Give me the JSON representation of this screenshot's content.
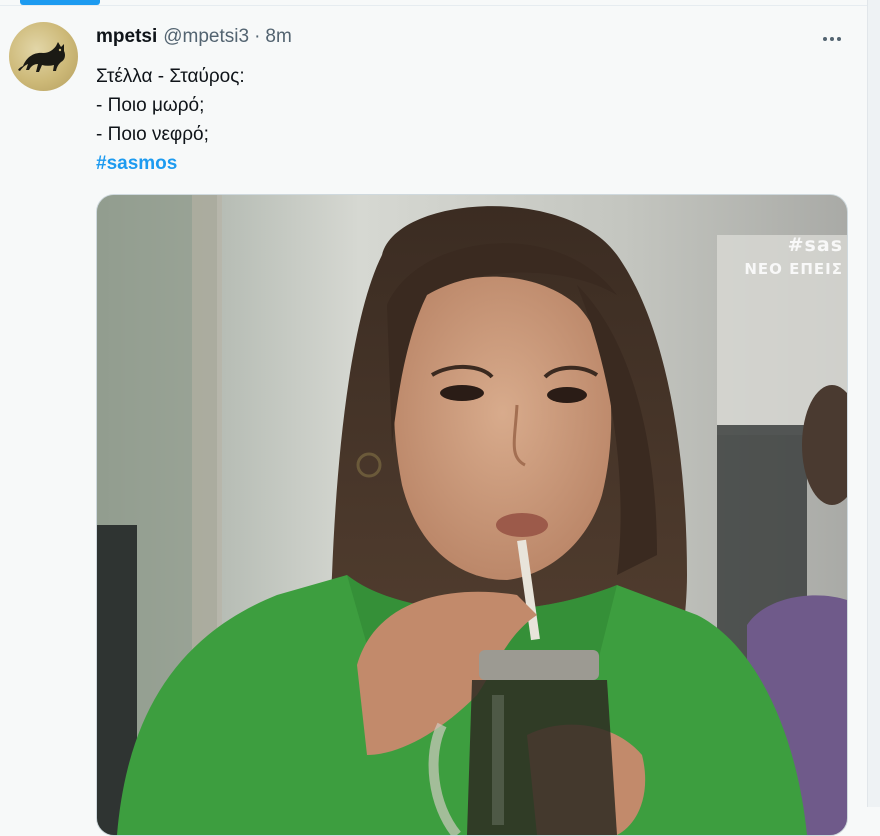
{
  "tweet": {
    "display_name": "mpetsi",
    "handle": "@mpetsi3",
    "separator": "·",
    "time": "8m",
    "text_lines": [
      "Στέλλα - Σταύρος:",
      "- Ποιο μωρό;",
      "- Ποιο νεφρό;"
    ],
    "hashtag": "#sasmos"
  },
  "media": {
    "watermark_tag": "#sas",
    "watermark_sub": "ΝΕΟ ΕΠΕΙΣ"
  },
  "icons": {
    "avatar": "black-cat-icon",
    "more": "more-options-icon"
  },
  "colors": {
    "accent": "#1d9bf0",
    "text": "#0f1419",
    "muted": "#536471",
    "background": "#f7f9f9"
  }
}
